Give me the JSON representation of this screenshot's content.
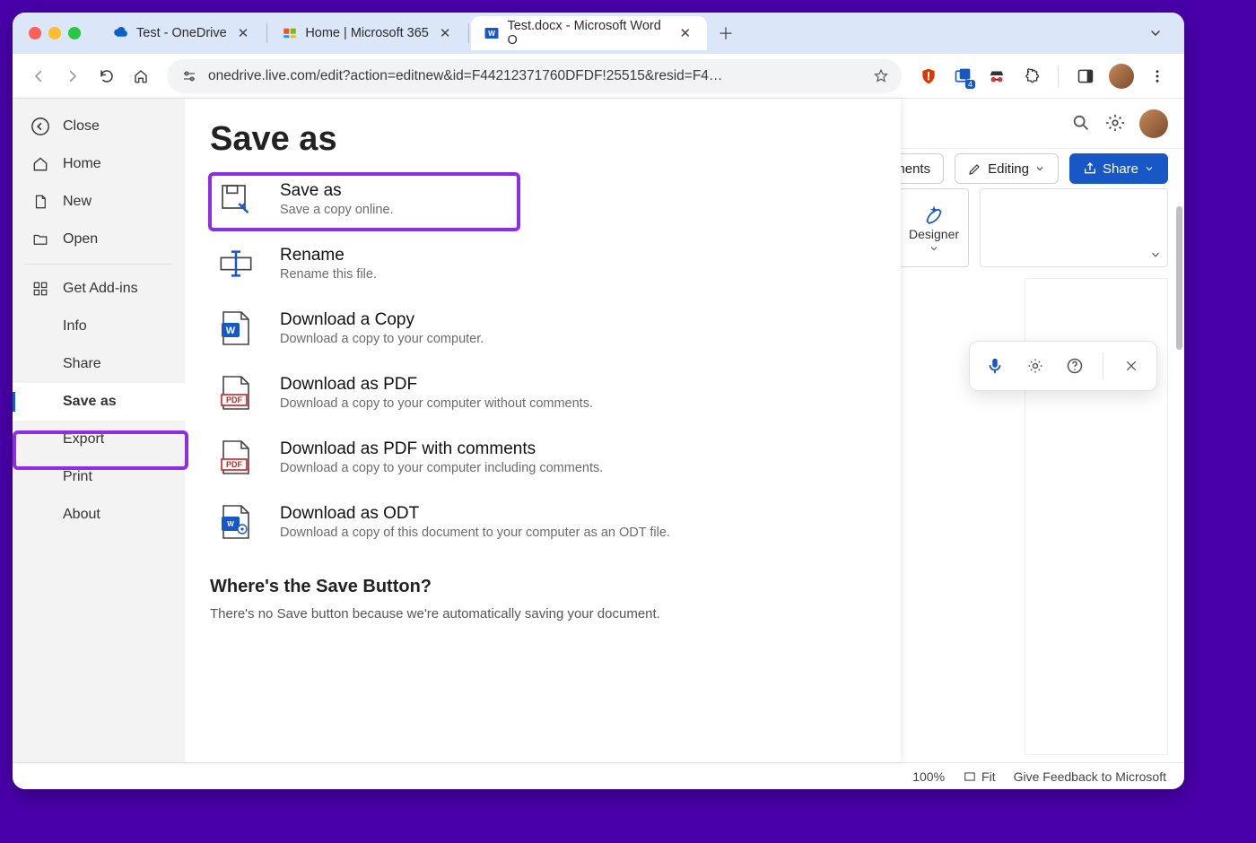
{
  "browser": {
    "tabs": [
      {
        "title": "Test - OneDrive",
        "active": false,
        "fav": "onedrive"
      },
      {
        "title": "Home | Microsoft 365",
        "active": false,
        "fav": "m365"
      },
      {
        "title": "Test.docx - Microsoft Word O",
        "active": true,
        "fav": "word"
      }
    ],
    "url": "onedrive.live.com/edit?action=editnew&id=F44212371760DFDF!25515&resid=F4…"
  },
  "word": {
    "comments_label": "omments",
    "editing_label": "Editing",
    "share_label": "Share",
    "designer_label": "Designer",
    "zoom": "100%",
    "fit": "Fit",
    "feedback": "Give Feedback to Microsoft"
  },
  "file": {
    "page_title": "Save as",
    "nav": {
      "close": "Close",
      "home": "Home",
      "new": "New",
      "open": "Open",
      "addins": "Get Add-ins",
      "info": "Info",
      "share": "Share",
      "saveas": "Save as",
      "export": "Export",
      "print": "Print",
      "about": "About"
    },
    "options": {
      "saveas": {
        "title": "Save as",
        "sub": "Save a copy online."
      },
      "rename": {
        "title": "Rename",
        "sub": "Rename this file."
      },
      "download": {
        "title": "Download a Copy",
        "sub": "Download a copy to your computer."
      },
      "pdf": {
        "title": "Download as PDF",
        "sub": "Download a copy to your computer without comments."
      },
      "pdf_comments": {
        "title": "Download as PDF with comments",
        "sub": "Download a copy to your computer including comments."
      },
      "odt": {
        "title": "Download as ODT",
        "sub": "Download a copy of this document to your computer as an ODT file."
      }
    },
    "help": {
      "title": "Where's the Save Button?",
      "body": "There's no Save button because we're automatically saving your document."
    }
  }
}
